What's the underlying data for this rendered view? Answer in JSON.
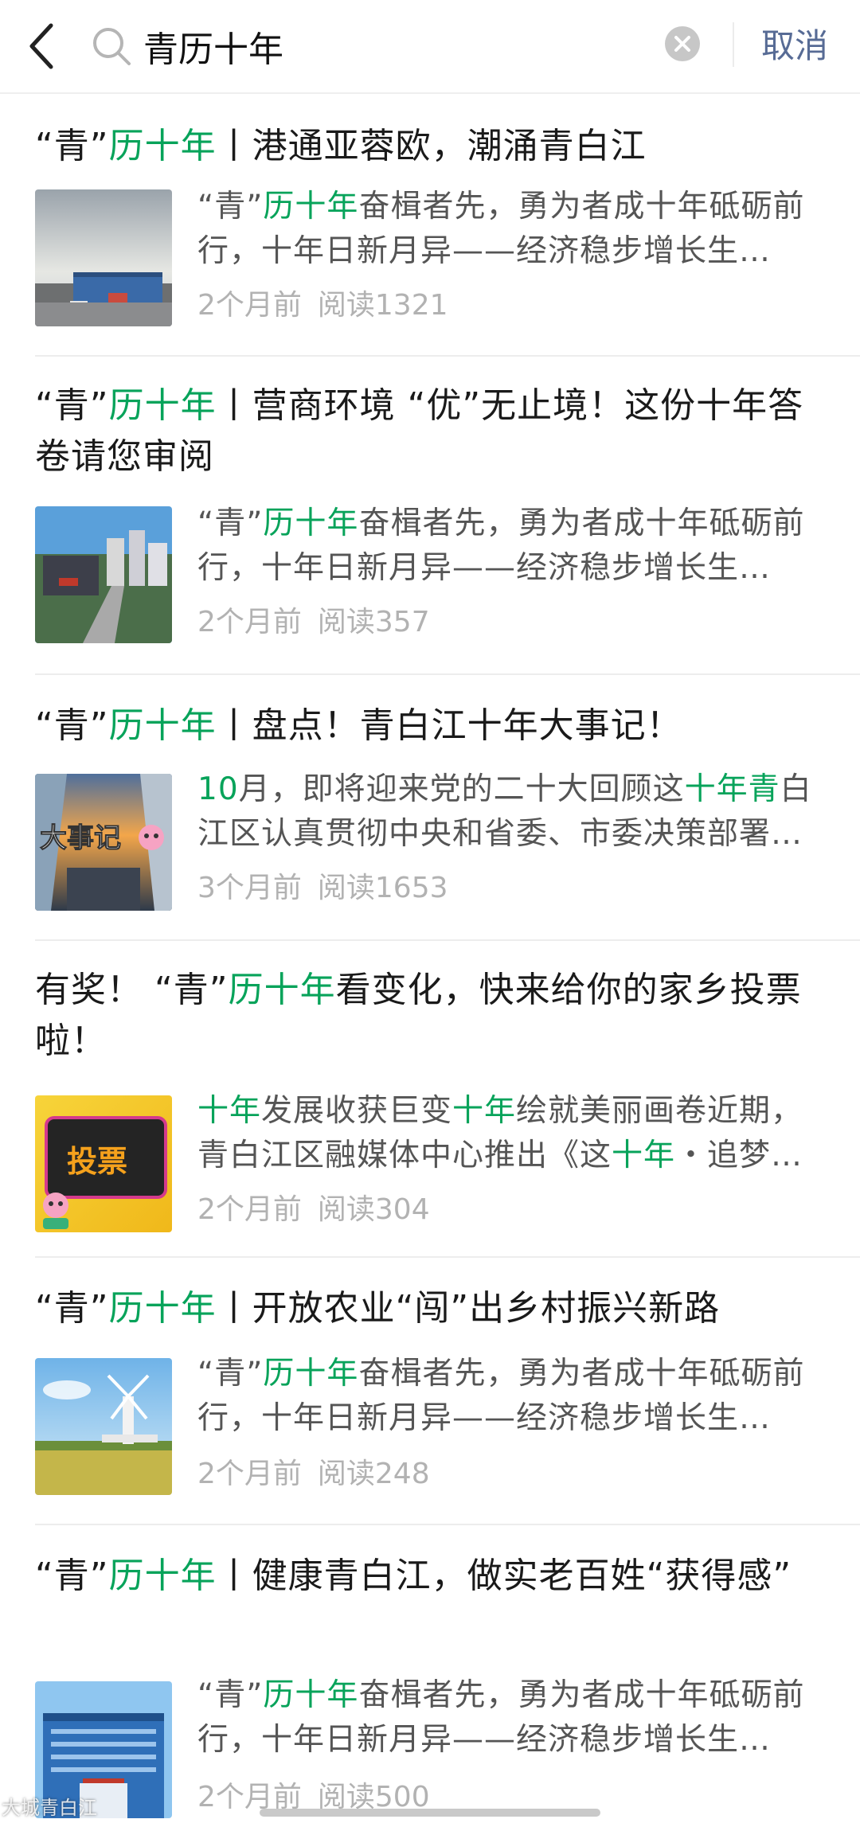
{
  "search": {
    "query": "青历十年",
    "cancel_label": "取消"
  },
  "colors": {
    "highlight": "#07a35a",
    "cancel": "#576b95",
    "meta": "#b2b2b2"
  },
  "results": [
    {
      "title_pre": "“青”",
      "title_hl": "历十年",
      "title_post": "丨港通亚蓉欧，潮涌青白江",
      "snippet": "“青”<em>历十年</em>奋楫者先，勇为者成十年砥砺前行，十年日新月异——经济稳步增长生…",
      "time": "2个月前",
      "reads": "阅读1321",
      "thumb_icon": "city-street-photo"
    },
    {
      "title_pre": "“青”",
      "title_hl": "历十年",
      "title_post": "丨营商环境 “优”无止境！这份十年答卷请您审阅",
      "snippet": "“青”<em>历十年</em>奋楫者先，勇为者成十年砥砺前行，十年日新月异——经济稳步增长生…",
      "time": "2个月前",
      "reads": "阅读357",
      "thumb_icon": "aerial-city-photo"
    },
    {
      "title_pre": "“青”",
      "title_hl": "历十年",
      "title_post": "丨盘点！青白江十年大事记！",
      "snippet": "<em>10</em>月，即将迎来党的二十大回顾这<em>十年青</em>白江区认真贯彻中央和省委、市委决策部署…",
      "time": "3个月前",
      "reads": "阅读1653",
      "thumb_icon": "events-collage",
      "thumb_text": "大事记"
    },
    {
      "title_pre": "有奖！ “青”",
      "title_hl": "历十年",
      "title_post": "看变化，快来给你的家乡投票啦！",
      "snippet": "<em>十年</em>发展收获巨变<em>十年</em>绘就美丽画卷近期，青白江区融媒体中心推出《这<em>十年</em>・追梦…",
      "time": "2个月前",
      "reads": "阅读304",
      "thumb_icon": "vote-badge",
      "thumb_text": "投票"
    },
    {
      "title_pre": "“青”",
      "title_hl": "历十年",
      "title_post": "丨开放农业“闯”出乡村振兴新路",
      "snippet": "“青”<em>历十年</em>奋楫者先，勇为者成十年砥砺前行，十年日新月异——经济稳步增长生…",
      "time": "2个月前",
      "reads": "阅读248",
      "thumb_icon": "windmill-field-photo"
    },
    {
      "title_pre": "“青”",
      "title_hl": "历十年",
      "title_post": "丨健康青白江，做实老百姓“获得感”",
      "snippet": "“青”<em>历十年</em>奋楫者先，勇为者成十年砥砺前行，十年日新月异——经济稳步增长生…",
      "time": "2个月前",
      "reads": "阅读500",
      "thumb_icon": "hospital-building-photo"
    }
  ],
  "watermark": "大城青白江"
}
